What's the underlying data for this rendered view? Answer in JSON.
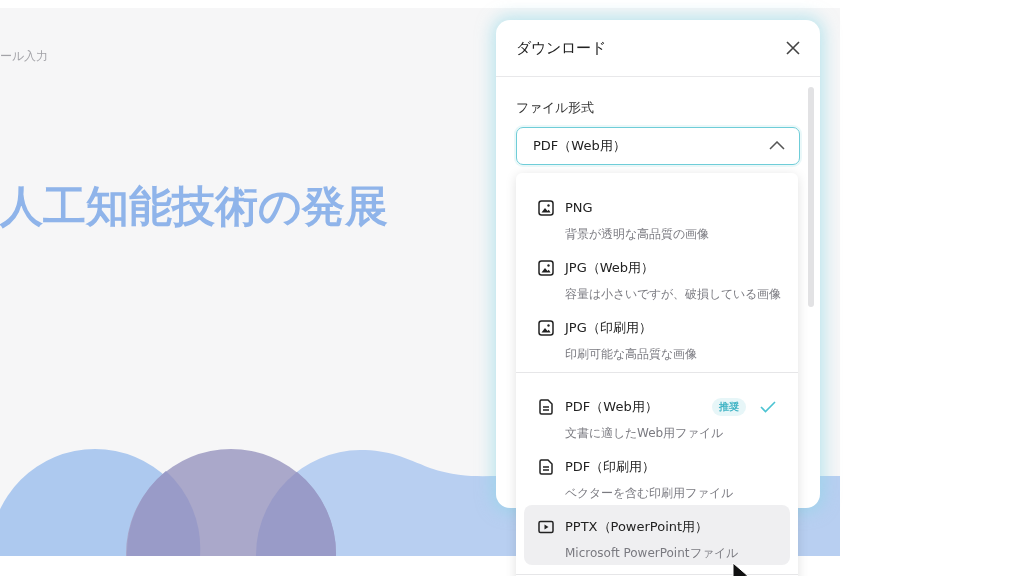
{
  "slide": {
    "hint": "ール入力",
    "title": "人工知能技術の発展"
  },
  "dialog": {
    "title": "ダウンロード",
    "field_label": "ファイル形式",
    "select": {
      "value": "PDF（Web用）",
      "expanded": true
    }
  },
  "menu": {
    "groups": [
      {
        "options": [
          {
            "kind": "image",
            "label": "PNG",
            "description": "背景が透明な高品質の画像",
            "selected": false,
            "hovered": false
          },
          {
            "kind": "image",
            "label": "JPG（Web用）",
            "description": "容量は小さいですが、破損している画像",
            "selected": false,
            "hovered": false
          },
          {
            "kind": "image",
            "label": "JPG（印刷用）",
            "description": "印刷可能な高品質な画像",
            "selected": false,
            "hovered": false
          }
        ]
      },
      {
        "options": [
          {
            "kind": "document",
            "label": "PDF（Web用）",
            "description": "文書に適したWeb用ファイル",
            "badge": "推奨",
            "selected": true,
            "hovered": false
          },
          {
            "kind": "document",
            "label": "PDF（印刷用）",
            "description": "ベクターを含む印刷用ファイル",
            "selected": false,
            "hovered": false
          },
          {
            "kind": "slideshow",
            "label": "PPTX（PowerPoint用）",
            "description": "Microsoft PowerPointファイル",
            "selected": false,
            "hovered": true
          }
        ]
      }
    ]
  }
}
